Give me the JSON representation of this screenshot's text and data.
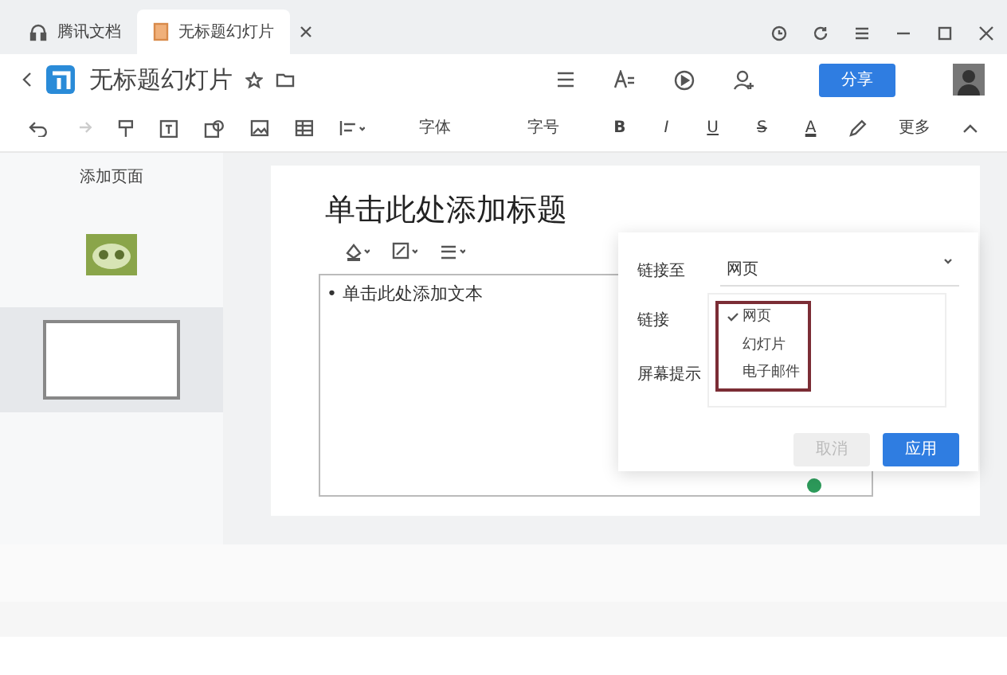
{
  "tabs": [
    {
      "label": "腾讯文档",
      "selected": false
    },
    {
      "label": "无标题幻灯片",
      "selected": true
    }
  ],
  "title": "无标题幻灯片",
  "share_button": "分享",
  "toolbar": [
    {
      "kind": "dropdown",
      "label": "字体"
    },
    {
      "kind": "dropdown",
      "label": "字号"
    },
    {
      "kind": "bold",
      "label": "B"
    },
    {
      "kind": "italic",
      "label": "I"
    },
    {
      "kind": "underline",
      "label": "U"
    },
    {
      "kind": "strike",
      "label": "S"
    },
    {
      "kind": "color",
      "label": "A"
    },
    {
      "kind": "more",
      "label": "更多"
    }
  ],
  "sidebar": {
    "add_page": "添加页面",
    "slides": [
      {
        "kind": "picture",
        "selected": false
      },
      {
        "kind": "blank",
        "selected": true
      }
    ]
  },
  "slide": {
    "title": "单击此处添加标题",
    "body": "• 单击此处添加文本"
  },
  "link_dialog": {
    "fields": [
      {
        "label": "链接至",
        "value": "网页"
      },
      {
        "label": "链接"
      },
      {
        "label": "屏幕提示"
      }
    ],
    "options": [
      {
        "label": "网页",
        "checked": true
      },
      {
        "label": "幻灯片",
        "checked": false
      },
      {
        "label": "电子邮件",
        "checked": false
      }
    ],
    "buttons": [
      {
        "label": "取消",
        "primary": false
      },
      {
        "label": "应用",
        "primary": true
      }
    ]
  }
}
